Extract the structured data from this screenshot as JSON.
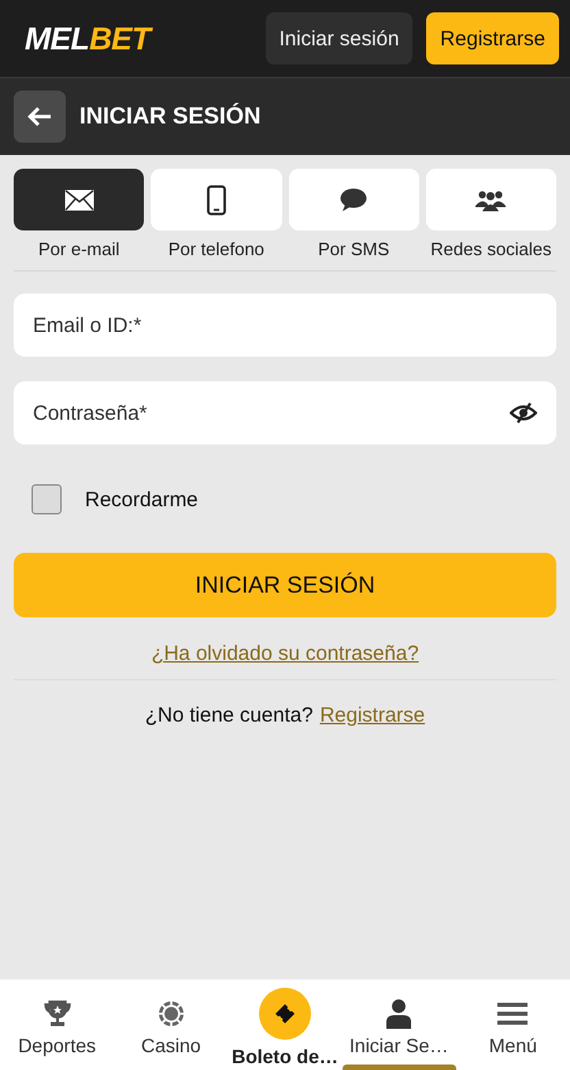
{
  "header": {
    "logo": {
      "first": "MEL",
      "second": "BET"
    },
    "login_button": "Iniciar sesión",
    "register_button": "Registrarse"
  },
  "page_title": "INICIAR SESIÓN",
  "methods": [
    {
      "kind": "email",
      "label": "Por e-mail",
      "selected": true
    },
    {
      "kind": "phone",
      "label": "Por telefono",
      "selected": false
    },
    {
      "kind": "sms",
      "label": "Por SMS",
      "selected": false
    },
    {
      "kind": "social",
      "label": "Redes sociales",
      "selected": false
    }
  ],
  "fields": [
    {
      "placeholder": "Email o ID:*",
      "kind": "text"
    },
    {
      "placeholder": "Contraseña*",
      "kind": "password"
    }
  ],
  "remember": {
    "label": "Recordarme",
    "checked": false
  },
  "submit": "INICIAR SESIÓN",
  "forgot_link": "¿Ha olvidado su contraseña?",
  "signup": {
    "question": "¿No tiene cuenta?",
    "link": "Registrarse"
  },
  "nav": [
    {
      "kind": "trophy",
      "label": "Deportes",
      "selected": false,
      "featured": false
    },
    {
      "kind": "chip",
      "label": "Casino",
      "selected": false,
      "featured": false
    },
    {
      "kind": "ticket",
      "label": "Boleto de…",
      "selected": false,
      "featured": true
    },
    {
      "kind": "person",
      "label": "Iniciar Se…",
      "selected": true,
      "featured": false
    },
    {
      "kind": "menu",
      "label": "Menú",
      "selected": false,
      "featured": false
    }
  ]
}
